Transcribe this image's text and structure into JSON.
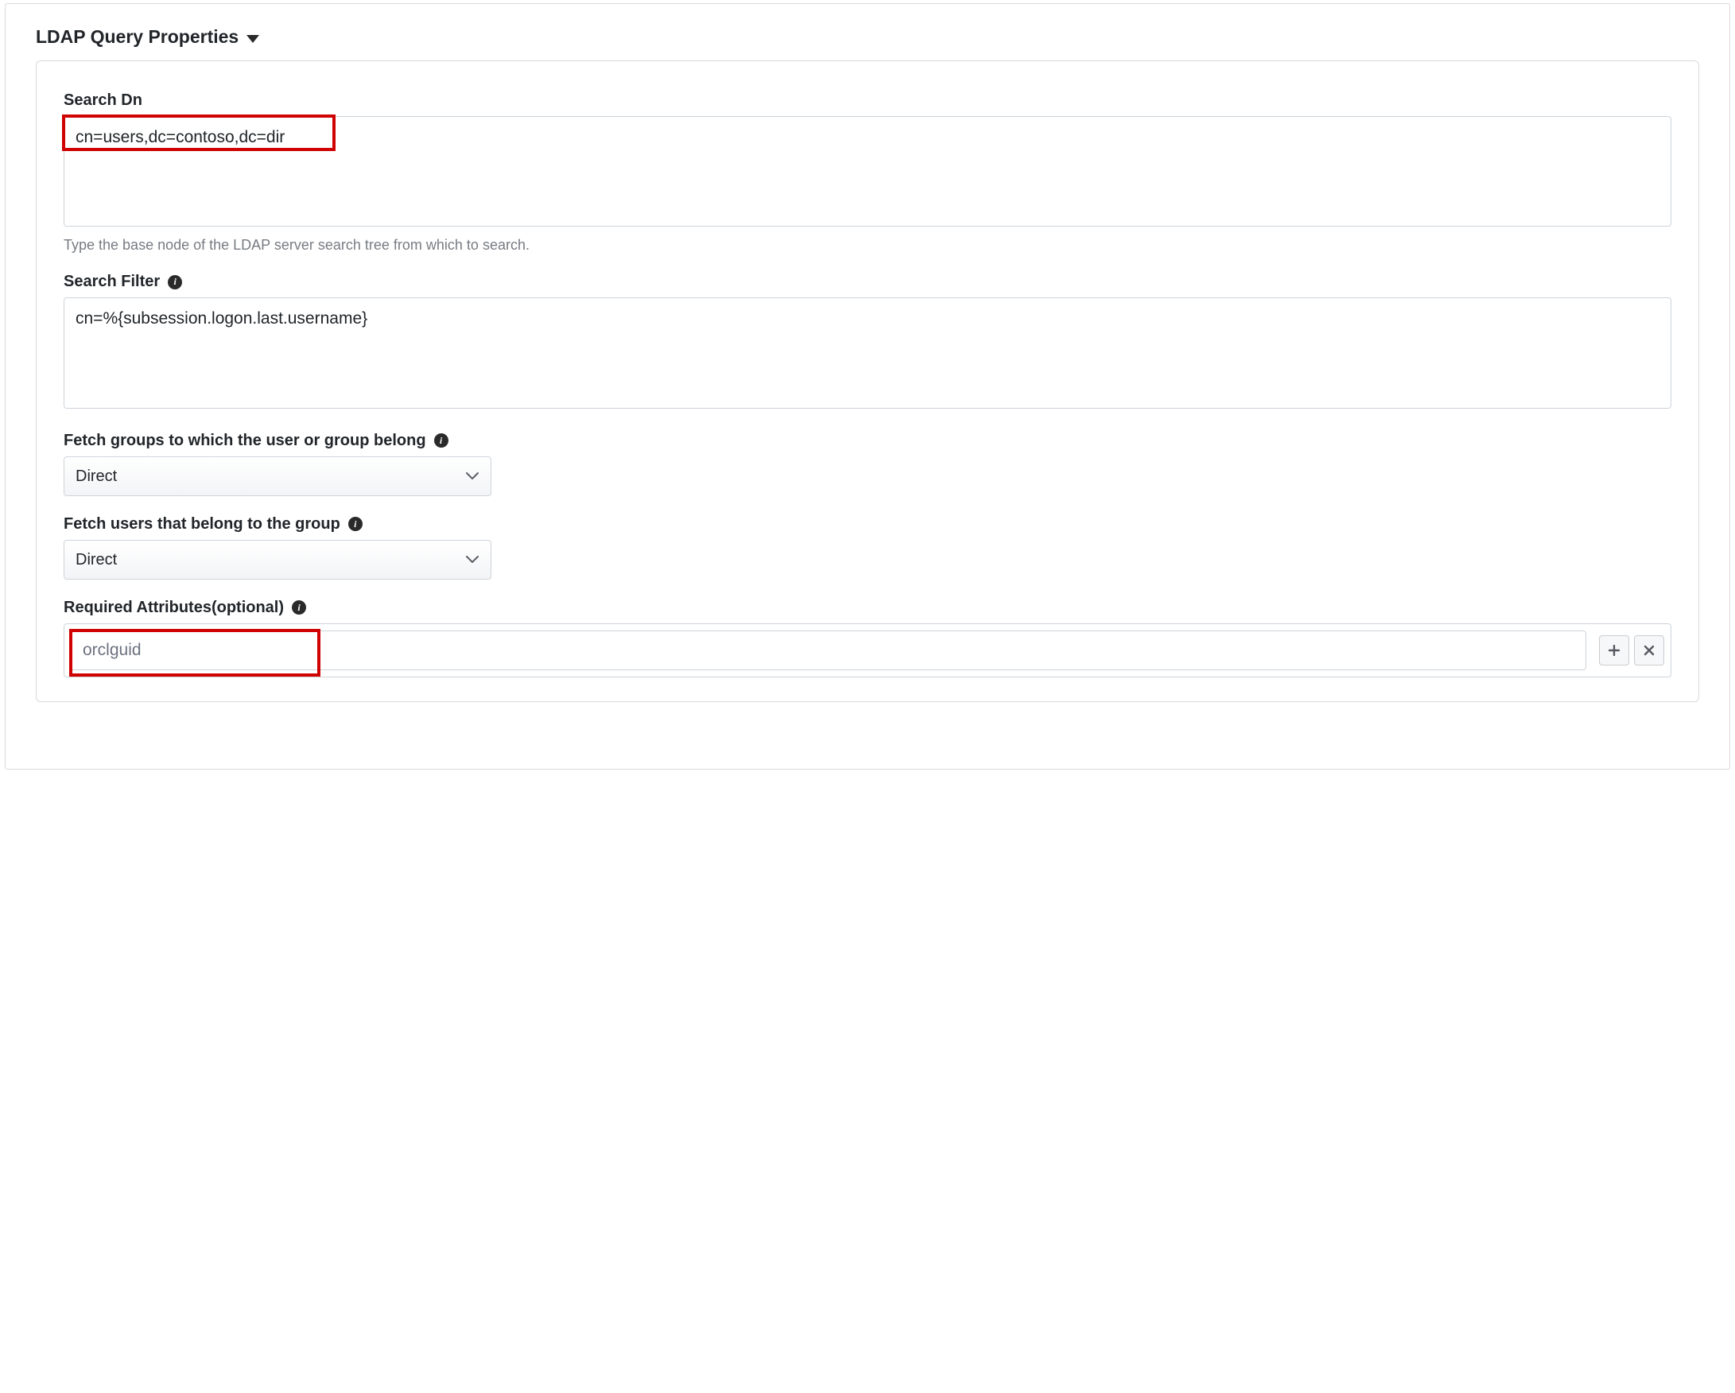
{
  "section": {
    "title": "LDAP Query Properties"
  },
  "fields": {
    "searchDn": {
      "label": "Search Dn",
      "value": "cn=users,dc=contoso,dc=dir",
      "help": "Type the base node of the LDAP server search tree from which to search."
    },
    "searchFilter": {
      "label": "Search Filter",
      "value": "cn=%{subsession.logon.last.username}"
    },
    "fetchGroups": {
      "label": "Fetch groups to which the user or group belong",
      "value": "Direct"
    },
    "fetchUsers": {
      "label": "Fetch users that belong to the group",
      "value": "Direct"
    },
    "requiredAttributes": {
      "label": "Required Attributes(optional)",
      "placeholder": "orclguid"
    }
  },
  "icons": {
    "info": "i"
  }
}
